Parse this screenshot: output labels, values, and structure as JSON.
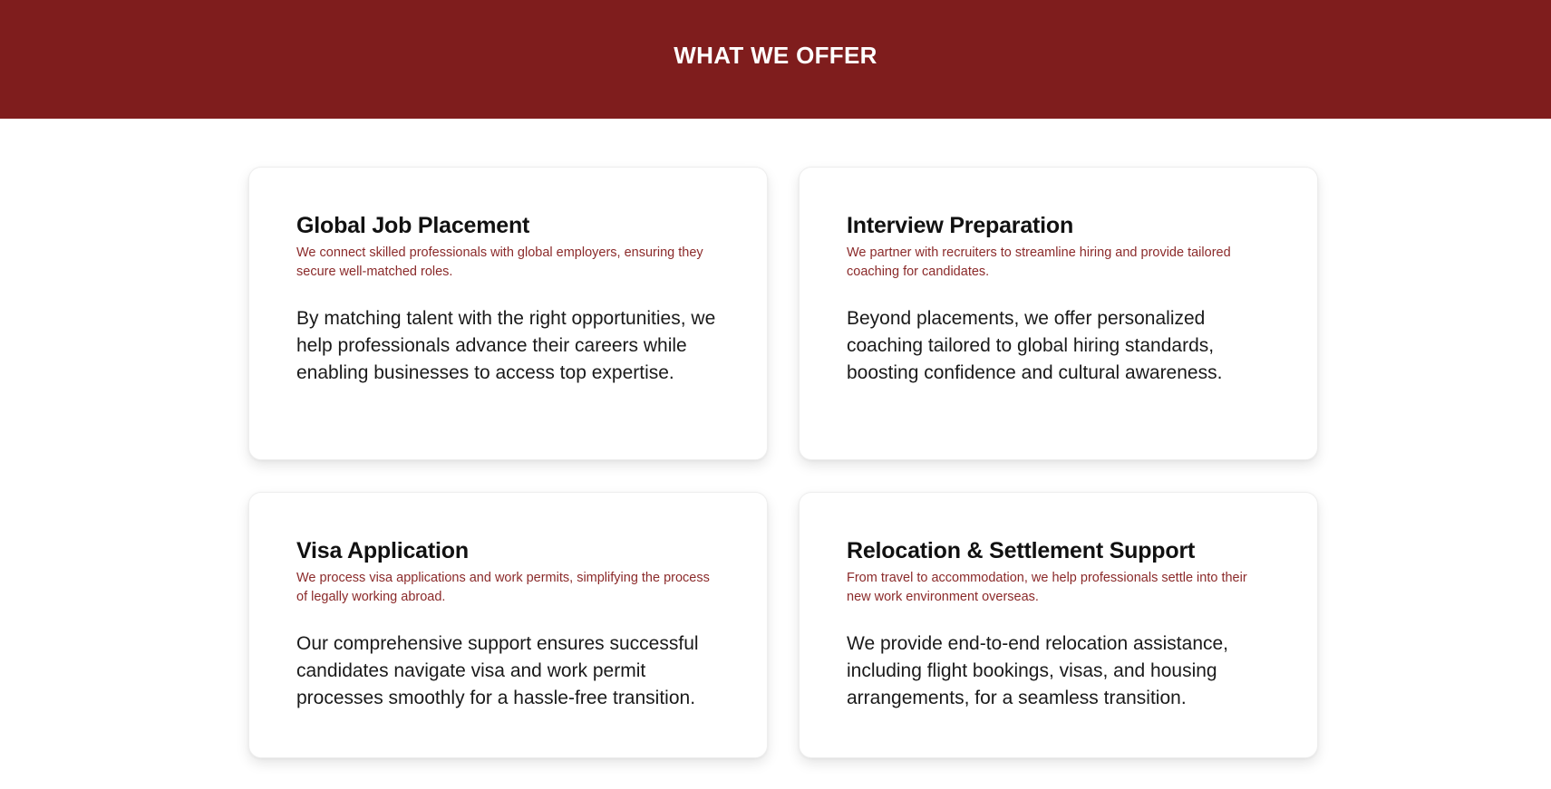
{
  "header": {
    "title": "WHAT WE OFFER",
    "background_color": "#7f1d1d"
  },
  "cards": [
    {
      "title": "Global Job Placement",
      "subtitle": "We connect skilled professionals with global employers, ensuring they secure well-matched roles.",
      "body": "By matching talent with the right opportunities, we help professionals advance their careers while enabling businesses to access top expertise."
    },
    {
      "title": "Interview Preparation",
      "subtitle": "We partner with recruiters to streamline hiring and provide tailored coaching for candidates.",
      "body": "Beyond placements, we offer personalized coaching tailored to global hiring standards, boosting confidence and cultural awareness."
    },
    {
      "title": "Visa Application",
      "subtitle": "We process visa applications and work permits, simplifying the process of legally working abroad.",
      "body": "Our comprehensive support ensures successful candidates navigate visa and work permit processes smoothly for a hassle-free transition."
    },
    {
      "title": "Relocation & Settlement Support",
      "subtitle": "From travel to accommodation, we help professionals settle into their new work environment overseas.",
      "body": "We provide end-to-end relocation assistance, including flight bookings, visas, and housing arrangements, for a seamless transition."
    }
  ],
  "colors": {
    "accent": "#7f1d1d",
    "subtitle_text": "#8b2a2a",
    "body_text": "#1a1a1a"
  }
}
